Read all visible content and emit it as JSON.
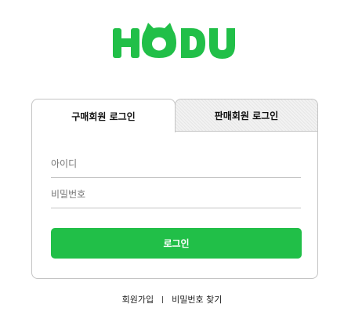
{
  "logo": {
    "text": "HODU",
    "color": "#21bf48"
  },
  "tabs": [
    {
      "label": "구매회원 로그인",
      "active": true
    },
    {
      "label": "판매회원 로그인",
      "active": false
    }
  ],
  "form": {
    "id_placeholder": "아이디",
    "id_value": "",
    "password_placeholder": "비밀번호",
    "password_value": "",
    "login_label": "로그인"
  },
  "footer": {
    "signup_label": "회원가입",
    "find_password_label": "비밀번호 찾기"
  },
  "colors": {
    "accent": "#21bf48",
    "border": "#c4c4c4",
    "inactive_tab_bg": "#f2f2f2"
  }
}
